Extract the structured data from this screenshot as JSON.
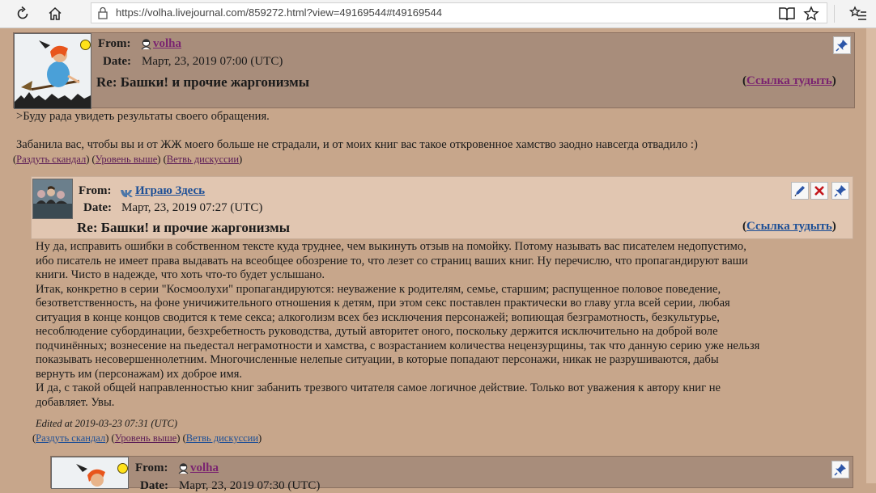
{
  "browser": {
    "url": "https://volha.livejournal.com/859272.html?view=49169544#t49169544",
    "icons": [
      "refresh-icon",
      "home-icon",
      "lock-icon",
      "reader-view-icon",
      "favorite-star-icon",
      "favorites-list-icon"
    ]
  },
  "comments": [
    {
      "from_label": "From:",
      "user": "volha",
      "date_label": "Date:",
      "date": "Март, 23, 2019 07:00 (UTC)",
      "subject": "Re: Башки! и прочие жаргонизмы",
      "permalink_open": "(",
      "permalink": "Ссылка тудыть",
      "permalink_close": ")",
      "body": [
        ">Буду рада увидеть результаты своего обращения.",
        "Забанила вас, чтобы вы и от ЖЖ моего больше не страдали, и от моих книг вас такое откровенное хамство заодно навсегда отвадило :)"
      ],
      "actions": [
        "Раздуть скандал",
        "Уровень выше",
        "Ветвь дискуссии"
      ]
    },
    {
      "from_label": "From:",
      "user": "Играю Здесь",
      "date_label": "Date:",
      "date": "Март, 23, 2019 07:27 (UTC)",
      "subject": "Re: Башки! и прочие жаргонизмы",
      "permalink_open": "(",
      "permalink": "Ссылка тудыть",
      "permalink_close": ")",
      "body_lines": [
        "Ну да, исправить ошибки в собственном тексте куда труднее, чем выкинуть отзыв на помойку. Потому называть вас писателем недопустимо,",
        "ибо писатель не имеет права выдавать на всеобщее обозрение то, что лезет со страниц ваших книг. Ну перечислю, что пропагандируют ваши",
        "книги. Чисто в надежде, что хоть что-то будет услышано.",
        "Итак, конкретно в серии \"Космоолухи\" пропагандируются: неуважение к родителям, семье, старшим; распущенное половое поведение,",
        "безответственность, на фоне уничижительного отношения к детям, при этом секс поставлен практически во главу угла всей серии, любая",
        "ситуация в конце концов сводится к теме секса; алкоголизм всех без исключения персонажей; вопиющая безграмотность, безкультурье,",
        "несоблюдение субординации, безхребетность руководства, дутый авторитет оного, поскольку держится исключительно на доброй воле",
        "подчинённых; вознесение на пьедестал неграмотности и хамства, с возрастанием количества нецензурщины, так что данную серию уже нельзя",
        "показывать несовершеннолетним. Многочисленные нелепые ситуации, в которые попадают персонажи, никак не разрушиваются, дабы",
        "вернуть им (персонажам) их доброе имя.",
        "И да, с такой общей направленностью книг забанить трезвого читателя самое логичное действие. Только вот уважения к автору книг не",
        "добавляет. Увы."
      ],
      "edited": "Edited at 2019-03-23 07:31 (UTC)",
      "actions": [
        "Раздуть скандал",
        "Уровень выше",
        "Ветвь дискуссии"
      ]
    },
    {
      "from_label": "From:",
      "user": "volha",
      "date_label": "Date:",
      "date": "Март, 23, 2019 07:30 (UTC)"
    }
  ],
  "colors": {
    "page_bg": "#c7a68b",
    "head_dark": "#a88d7b",
    "head_light": "#e1c6b1",
    "link_purple": "#7a2370",
    "link_blue": "#1d4f96"
  }
}
